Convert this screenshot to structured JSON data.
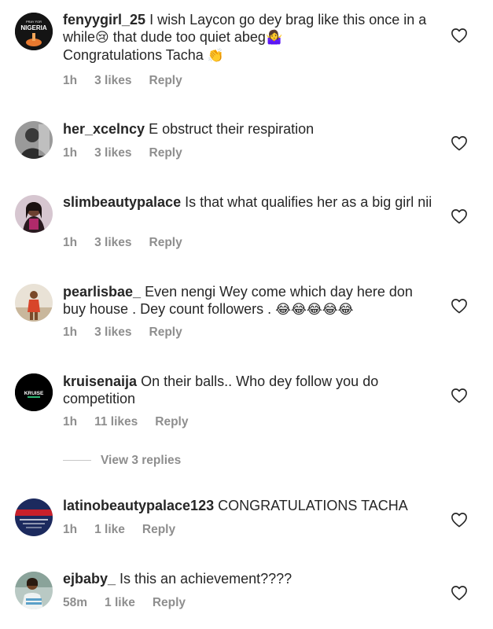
{
  "comments": [
    {
      "username": "fenyygirl_25",
      "text": " I wish Laycon go dey brag like this once in a while",
      "emoji1": "😢",
      "text2": " that dude too quiet abeg",
      "emoji2": "🤷‍♀️",
      "line2": "Congratulations Tacha ",
      "emoji3": "👏",
      "time": "1h",
      "likes": "3 likes",
      "reply": "Reply",
      "avatar_text_top": "PRAY FOR",
      "avatar_text": "NIGERIA"
    },
    {
      "username": "her_xcelncy",
      "text": " E obstruct their respiration",
      "time": "1h",
      "likes": "3 likes",
      "reply": "Reply"
    },
    {
      "username": "slimbeautypalace",
      "text": " Is that what qualifies her as a big girl nii",
      "time": "1h",
      "likes": "3 likes",
      "reply": "Reply"
    },
    {
      "username": "pearlisbae_",
      "text": " Even nengi Wey come which day here don buy house . Dey count followers . ",
      "emoji": "😂😂😂😂😂",
      "time": "1h",
      "likes": "3 likes",
      "reply": "Reply"
    },
    {
      "username": "kruisenaija",
      "text": " On their balls.. Who dey follow you do competition",
      "time": "1h",
      "likes": "11 likes",
      "reply": "Reply",
      "avatar_text": "KRUISE"
    },
    {
      "username": "latinobeautypalace123",
      "text": " CONGRATULATIONS TACHA",
      "time": "1h",
      "likes": "1 like",
      "reply": "Reply"
    },
    {
      "username": "ejbaby_",
      "text": " Is this an achievement????",
      "time": "58m",
      "likes": "1 like",
      "reply": "Reply"
    }
  ],
  "view_replies": "View 3 replies",
  "colors": {
    "text": "#262626",
    "meta": "#8e8e8e"
  },
  "icons": {
    "like": "heart-outline-icon"
  }
}
